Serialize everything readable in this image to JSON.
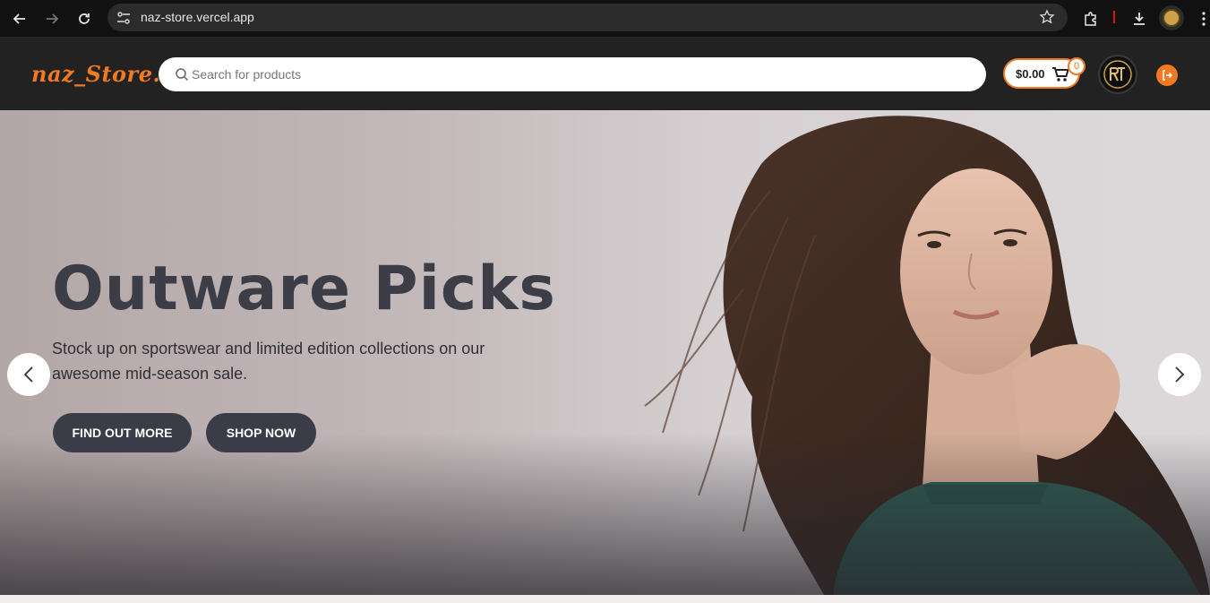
{
  "browser": {
    "url": "naz-store.vercel.app"
  },
  "header": {
    "logo": "naz_Store.",
    "search_placeholder": "Search for products",
    "cart_total": "$0.00",
    "cart_count": "0"
  },
  "hero": {
    "title": "Outware Picks",
    "description": "Stock up on sportswear and limited edition collections on our awesome mid-season sale.",
    "find_out_more": "FIND OUT MORE",
    "shop_now": "SHOP NOW"
  },
  "colors": {
    "brand": "#f07a24",
    "header_bg": "#222222",
    "button_bg": "#3a3c47"
  }
}
